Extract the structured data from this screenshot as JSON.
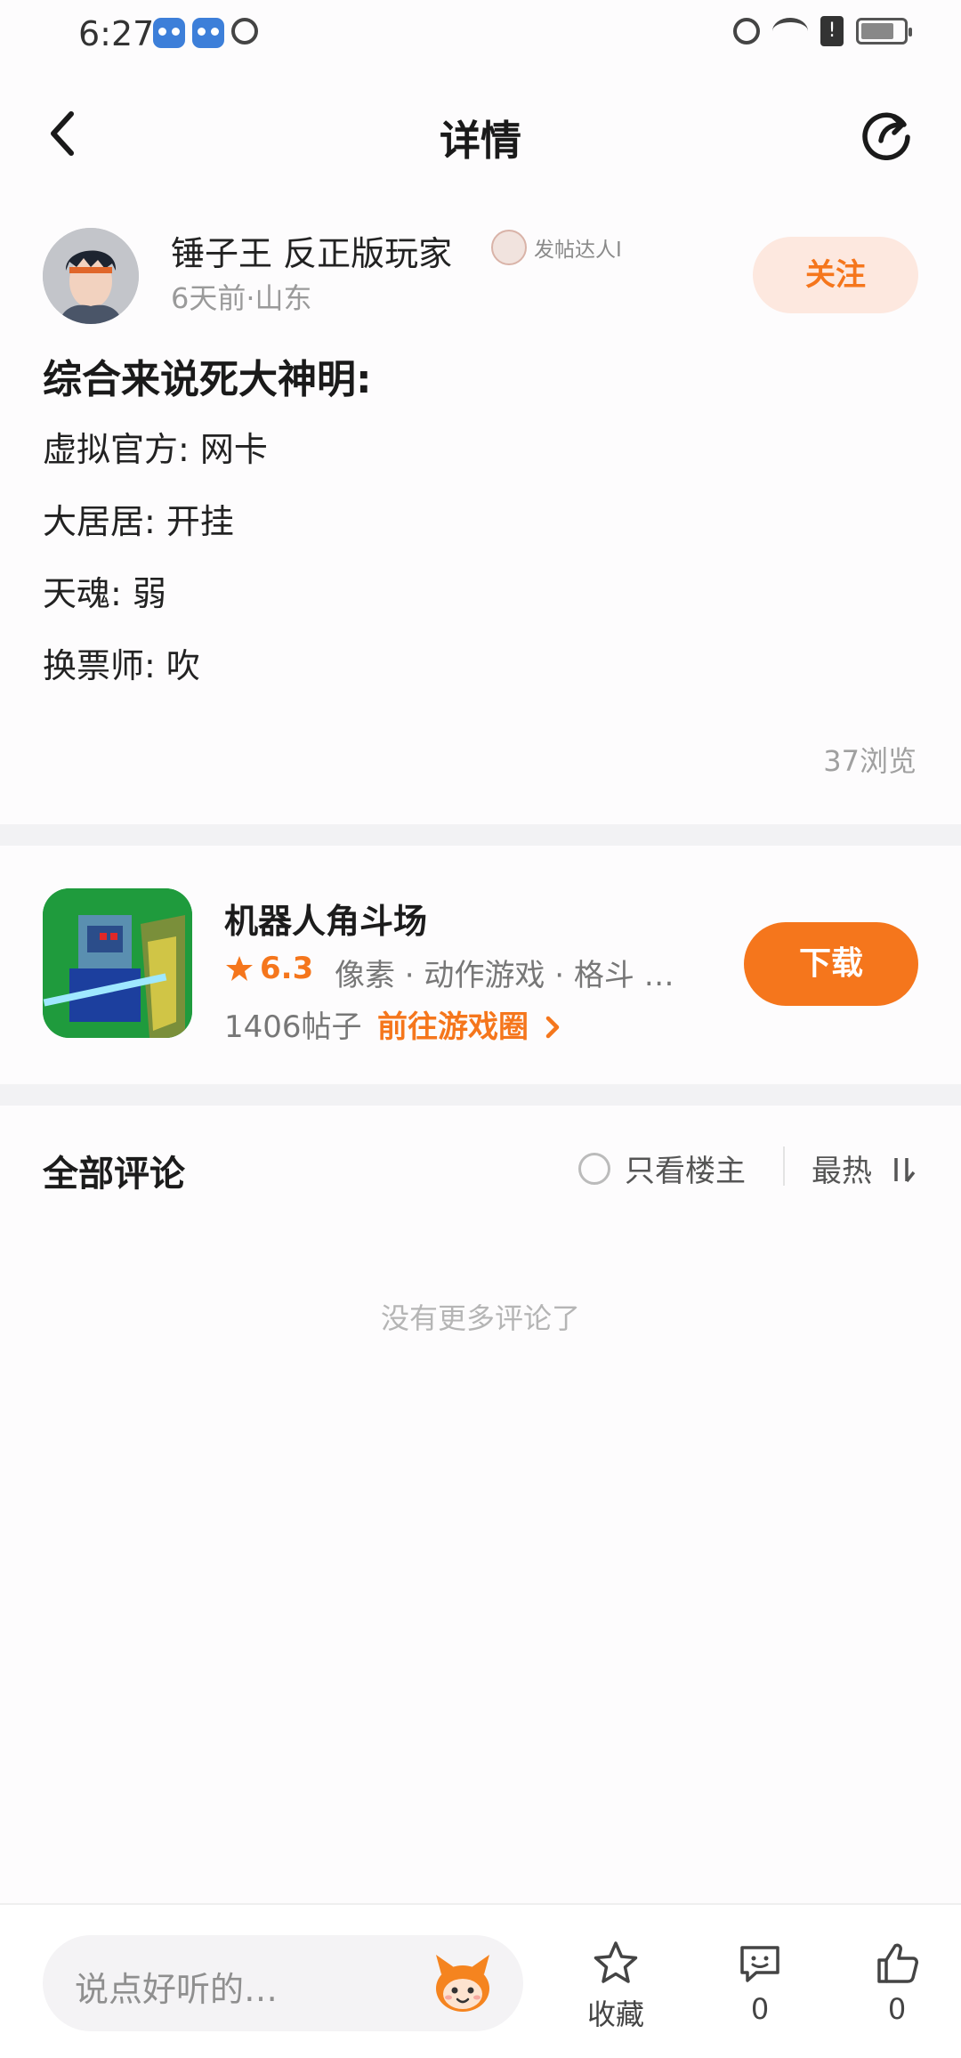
{
  "status_bar": {
    "time": "6:27"
  },
  "header": {
    "title": "详情"
  },
  "author": {
    "name": "锤子王 反正版玩家",
    "badge": "发帖达人I",
    "meta": "6天前·山东",
    "follow_label": "关注"
  },
  "post": {
    "title": "综合来说死大神明:",
    "lines": [
      "虚拟官方: 网卡",
      "大居居: 开挂",
      "天魂: 弱",
      "换票师: 吹"
    ],
    "views": "37浏览"
  },
  "game": {
    "name": "机器人角斗场",
    "rating": "6.3",
    "tags": "像素 · 动作游戏 · 格斗 …",
    "post_count": "1406帖子",
    "goto_label": "前往游戏圈",
    "download_label": "下载"
  },
  "comments": {
    "title": "全部评论",
    "op_only_label": "只看楼主",
    "sort_label": "最热",
    "empty_text": "没有更多评论了"
  },
  "bottom_bar": {
    "input_placeholder": "说点好听的…",
    "favorite_label": "收藏",
    "comment_count": "0",
    "like_count": "0"
  },
  "colors": {
    "accent": "#f5761c",
    "follow_bg": "#fde8df",
    "divider": "#f2f2f4"
  }
}
